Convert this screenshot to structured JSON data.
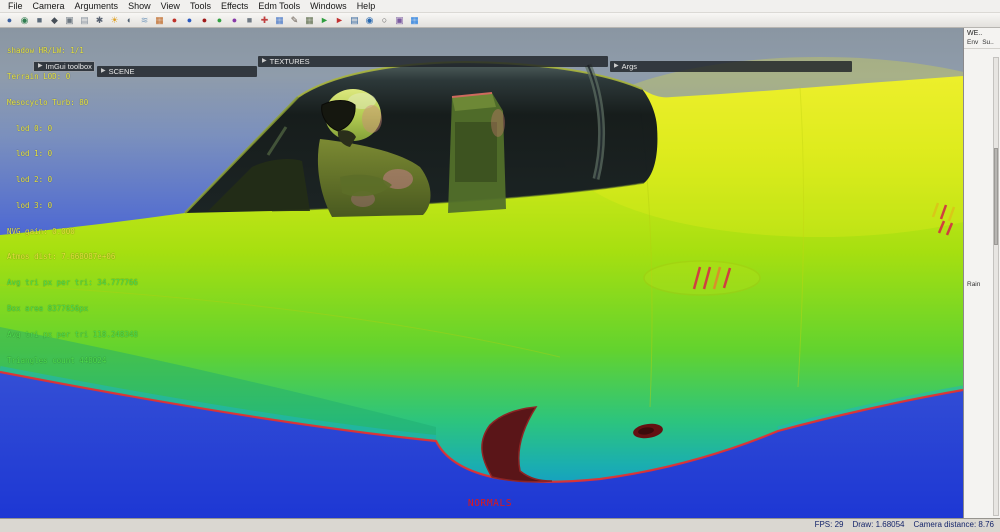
{
  "menubar": {
    "items": [
      "File",
      "Camera",
      "Arguments",
      "Show",
      "View",
      "Tools",
      "Effects",
      "Edm Tools",
      "Windows",
      "Help"
    ]
  },
  "toolbar": {
    "icons": [
      {
        "name": "scene-sphere-icon",
        "glyph": "●",
        "color": "#3a5f9e"
      },
      {
        "name": "globe-icon",
        "glyph": "◉",
        "color": "#2f7d4f"
      },
      {
        "name": "save-icon",
        "glyph": "■",
        "color": "#5a6a7a"
      },
      {
        "name": "camera-icon",
        "glyph": "◆",
        "color": "#464e57"
      },
      {
        "name": "screenshot-icon",
        "glyph": "▣",
        "color": "#6b7680"
      },
      {
        "name": "document-icon",
        "glyph": "▤",
        "color": "#8a94a0"
      },
      {
        "name": "settings-gear-icon",
        "glyph": "✱",
        "color": "#566070"
      },
      {
        "name": "sun-light-icon",
        "glyph": "☀",
        "color": "#e0a020"
      },
      {
        "name": "shadow-icon",
        "glyph": "◐",
        "color": "#506070"
      },
      {
        "name": "fog-icon",
        "glyph": "≋",
        "color": "#7fa0c0"
      },
      {
        "name": "palette-icon",
        "glyph": "▦",
        "color": "#c06a28"
      },
      {
        "name": "stop-icon",
        "glyph": "●",
        "color": "#c03028"
      },
      {
        "name": "play-icon",
        "glyph": "●",
        "color": "#2858c0"
      },
      {
        "name": "record-icon",
        "glyph": "●",
        "color": "#a01818"
      },
      {
        "name": "material-icon",
        "glyph": "●",
        "color": "#30a040"
      },
      {
        "name": "sphere-purple-icon",
        "glyph": "●",
        "color": "#8838a8"
      },
      {
        "name": "cube-icon",
        "glyph": "■",
        "color": "#707a84"
      },
      {
        "name": "axes-icon",
        "glyph": "✚",
        "color": "#c04040"
      },
      {
        "name": "grid-icon",
        "glyph": "▦",
        "color": "#4878c8"
      },
      {
        "name": "edit-pencil-icon",
        "glyph": "✎",
        "color": "#60554a"
      },
      {
        "name": "wireframe-icon",
        "glyph": "▦",
        "color": "#607050"
      },
      {
        "name": "flag-green-icon",
        "glyph": "►",
        "color": "#2f9e3f"
      },
      {
        "name": "flag-red-icon",
        "glyph": "►",
        "color": "#c23030"
      },
      {
        "name": "chart-icon",
        "glyph": "▤",
        "color": "#3a6aa0"
      },
      {
        "name": "world-icon",
        "glyph": "◉",
        "color": "#2868b0"
      },
      {
        "name": "search-icon",
        "glyph": "○",
        "color": "#555555"
      },
      {
        "name": "layers-icon",
        "glyph": "▣",
        "color": "#7a5aa0"
      },
      {
        "name": "grid-blue-icon",
        "glyph": "▦",
        "color": "#1f7ae0"
      }
    ]
  },
  "viewport": {
    "panel_arrow": "▶",
    "panels": [
      {
        "label": "ImGui toolbox"
      },
      {
        "label": "SCENE"
      },
      {
        "label": "TEXTURES"
      },
      {
        "label": "Args"
      }
    ],
    "debug_lines": [
      {
        "text": "shadow HR/LW: 1/1"
      },
      {
        "text": "Terrain LOD: 0"
      },
      {
        "text": "Mesocyclo Turb: 80"
      },
      {
        "text": "  lod 0: 0"
      },
      {
        "text": "  lod 1: 0"
      },
      {
        "text": "  lod 2: 0"
      },
      {
        "text": "  lod 3: 0"
      },
      {
        "text": "NVG gain: 0.000"
      },
      {
        "text": "Atmos dist: 7.668087e+06"
      },
      {
        "text": "Avg tri px per tri: 34.777766"
      },
      {
        "text": "Box area 8377656px"
      },
      {
        "text": "Avg tri px per tri 118.248348"
      },
      {
        "text": "Triangles count 448024"
      }
    ],
    "mode_label": "NORMALS"
  },
  "right_panel": {
    "title": "WE..",
    "tab_env": "Env",
    "tab_su": "Su..",
    "item_rain": "Rain"
  },
  "status_bar": {
    "fps": "FPS: 29",
    "draw": "Draw: 1.68054",
    "camera_distance": "Camera distance: 8.76"
  },
  "colors": {
    "sky_top": "#8a96a2",
    "sky_bottom": "#1d37d4",
    "body_yellow": "#eff033",
    "body_green": "#63d32e",
    "body_cyan_rim": "#1db4c4",
    "rim_red": "#e23232",
    "normals_red": "#e01818",
    "debug_yellow": "#e8e540",
    "debug_green": "#4fe04f",
    "panel_bg": "#f4f3f1"
  }
}
